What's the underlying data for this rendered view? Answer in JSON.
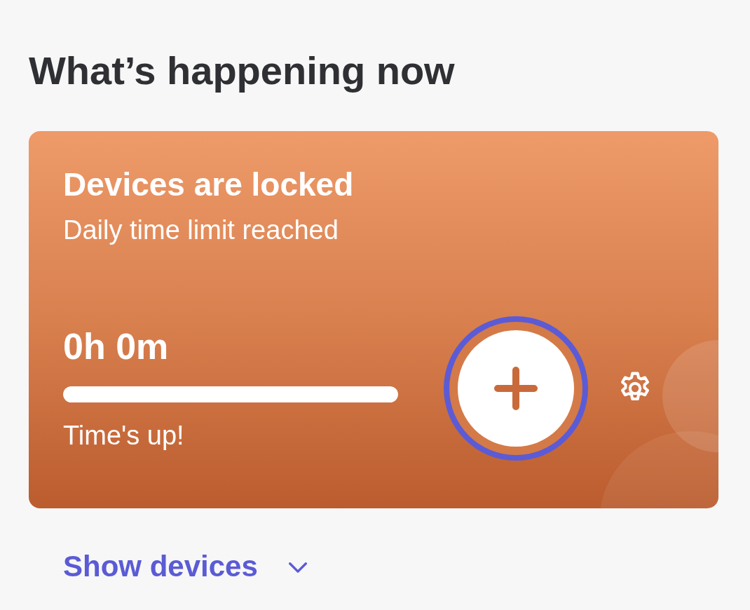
{
  "section_title": "What’s happening now",
  "status_card": {
    "title": "Devices are locked",
    "subtitle": "Daily time limit reached",
    "time_left": "0h 0m",
    "level": 1,
    "status_text": "Time's up!",
    "add_button": {
      "focused": true
    }
  },
  "show_devices_link": {
    "label": "Show devices",
    "expanded": false
  }
}
